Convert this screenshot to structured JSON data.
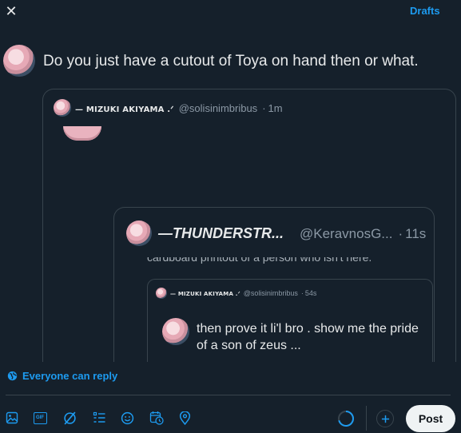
{
  "header": {
    "close_glyph": "✕",
    "drafts_label": "Drafts"
  },
  "compose": {
    "text": "Do you just have a cutout of Toya on hand then or what."
  },
  "quote1": {
    "display_name": "— MIZUKI AKIYAMA .ᐟ",
    "handle": "@solisinimbribus",
    "separator": "·",
    "time": "1m"
  },
  "quote2": {
    "display_name": "—THUNDERSTR...",
    "handle": "@KeravnosG...",
    "separator": "·",
    "time": "11s",
    "partial_text": "cardboard printout of a person who isn't here."
  },
  "quote3": {
    "display_name": "— MIZUKI AKIYAMA .ᐟ",
    "handle": "@solisinimbribus",
    "separator": "·",
    "time": "54s",
    "text": "then prove it li'l bro . show me the pride of a son of zeus ..."
  },
  "reply_setting": {
    "label": "Everyone can reply"
  },
  "toolbar": {
    "icons": [
      "image-icon",
      "gif-icon",
      "grok-icon",
      "poll-icon",
      "emoji-icon",
      "schedule-icon",
      "location-icon"
    ],
    "gif_label": "GIF",
    "post_label": "Post"
  },
  "colors": {
    "background": "#15202b",
    "accent": "#1d9bf0",
    "border": "#38444d",
    "muted": "#8b98a5"
  }
}
